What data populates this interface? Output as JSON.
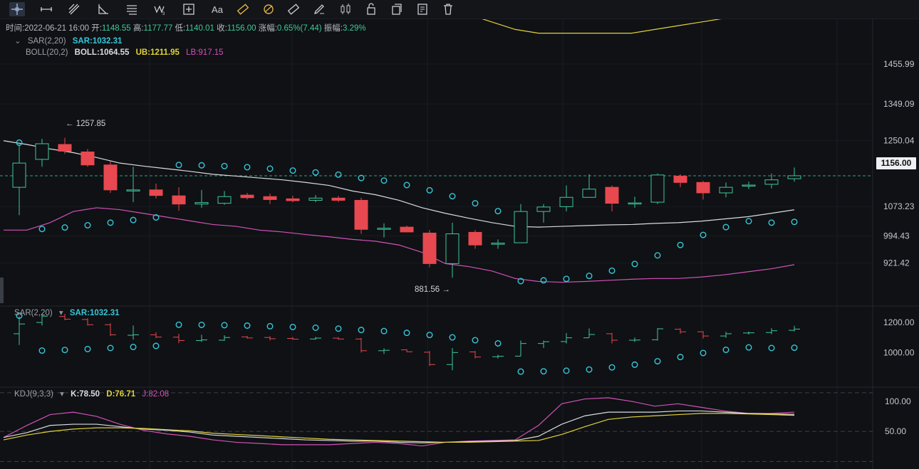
{
  "toolbar": {
    "icons": [
      "crosshair-icon",
      "horizontal-line-icon",
      "parallel-channel-icon",
      "triangle-icon",
      "fib-lines-icon",
      "wave-icon",
      "measure-icon",
      "text-icon",
      "pattern-icon",
      "gann-icon",
      "ruler-icon",
      "brush-icon",
      "candle-icon",
      "lock-icon",
      "copy-icon",
      "note-icon",
      "trash-icon"
    ],
    "text_tool": "Aa"
  },
  "header": {
    "time_label": "时间:",
    "time": "2022-06-21 16:00",
    "open_label": "开:",
    "open": "1148.55",
    "high_label": "高:",
    "high": "1177.77",
    "low_label": "低:",
    "low": "1140.01",
    "close_label": "收:",
    "close": "1156.00",
    "chg_label": "涨幅:",
    "chg": "0.65%(7.44)",
    "amp_label": "振幅:",
    "amp": "3.29%"
  },
  "legends": {
    "main_sar_name": "SAR(2,20)",
    "main_sar_value": "SAR:1032.31",
    "boll_name": "BOLL(20,2)",
    "boll_mid": "BOLL:1064.55",
    "boll_ub": "UB:1211.95",
    "boll_lb": "LB:917.15",
    "sub_sar_name": "SAR(2,20)",
    "sub_sar_value": "SAR:1032.31",
    "kdj_name": "KDJ(9,3,3)",
    "kdj_k": "K:78.50",
    "kdj_d": "D:76.71",
    "kdj_j": "J:82.08"
  },
  "annotations": {
    "high_mark": "← 1257.85",
    "low_mark": "881.56 →"
  },
  "price_tag": "1156.00",
  "colors": {
    "up": "#3fc89a",
    "down": "#e8484f",
    "ub": "#e2d23a",
    "mid": "#d8dbe0",
    "lb": "#d451b8",
    "sar": "#36c6d8",
    "k": "#d8dbe0",
    "d": "#e2d23a",
    "j": "#d451b8",
    "bg": "#0f1114"
  },
  "chart_data": {
    "type": "candlestick",
    "price_axis": {
      "ticks": [
        "1455.99",
        "1349.09",
        "1250.04",
        "1156.00",
        "1073.23",
        "994.43",
        "921.42"
      ],
      "ylim": [
        850,
        1500
      ]
    },
    "sar_axis": {
      "ticks": [
        "1200.00",
        "1000.00"
      ],
      "ylim": [
        850,
        1300
      ]
    },
    "kdj_axis": {
      "ticks": [
        "100.00",
        "50.00"
      ],
      "ylim": [
        -10,
        120
      ]
    },
    "candles": [
      {
        "o": 1125,
        "h": 1240,
        "l": 1050,
        "c": 1190
      },
      {
        "o": 1200,
        "h": 1255,
        "l": 1180,
        "c": 1242
      },
      {
        "o": 1240,
        "h": 1258,
        "l": 1215,
        "c": 1222
      },
      {
        "o": 1220,
        "h": 1228,
        "l": 1180,
        "c": 1185
      },
      {
        "o": 1185,
        "h": 1195,
        "l": 1110,
        "c": 1118
      },
      {
        "o": 1115,
        "h": 1180,
        "l": 1085,
        "c": 1118
      },
      {
        "o": 1118,
        "h": 1135,
        "l": 1095,
        "c": 1103
      },
      {
        "o": 1102,
        "h": 1125,
        "l": 1062,
        "c": 1080
      },
      {
        "o": 1080,
        "h": 1118,
        "l": 1070,
        "c": 1084
      },
      {
        "o": 1082,
        "h": 1115,
        "l": 1078,
        "c": 1100
      },
      {
        "o": 1104,
        "h": 1110,
        "l": 1092,
        "c": 1097
      },
      {
        "o": 1100,
        "h": 1108,
        "l": 1080,
        "c": 1092
      },
      {
        "o": 1094,
        "h": 1102,
        "l": 1085,
        "c": 1089
      },
      {
        "o": 1090,
        "h": 1104,
        "l": 1085,
        "c": 1096
      },
      {
        "o": 1096,
        "h": 1102,
        "l": 1085,
        "c": 1090
      },
      {
        "o": 1090,
        "h": 1097,
        "l": 1000,
        "c": 1012
      },
      {
        "o": 1012,
        "h": 1028,
        "l": 990,
        "c": 1015
      },
      {
        "o": 1018,
        "h": 1022,
        "l": 1004,
        "c": 1005
      },
      {
        "o": 1002,
        "h": 1010,
        "l": 910,
        "c": 920
      },
      {
        "o": 920,
        "h": 1030,
        "l": 882,
        "c": 1000
      },
      {
        "o": 1004,
        "h": 1010,
        "l": 960,
        "c": 970
      },
      {
        "o": 972,
        "h": 985,
        "l": 960,
        "c": 975
      },
      {
        "o": 976,
        "h": 1080,
        "l": 975,
        "c": 1060
      },
      {
        "o": 1060,
        "h": 1080,
        "l": 1030,
        "c": 1072
      },
      {
        "o": 1073,
        "h": 1130,
        "l": 1060,
        "c": 1098
      },
      {
        "o": 1098,
        "h": 1160,
        "l": 1098,
        "c": 1120
      },
      {
        "o": 1125,
        "h": 1130,
        "l": 1060,
        "c": 1082
      },
      {
        "o": 1082,
        "h": 1100,
        "l": 1070,
        "c": 1083
      },
      {
        "o": 1085,
        "h": 1162,
        "l": 1080,
        "c": 1158
      },
      {
        "o": 1155,
        "h": 1160,
        "l": 1125,
        "c": 1138
      },
      {
        "o": 1138,
        "h": 1142,
        "l": 1092,
        "c": 1110
      },
      {
        "o": 1110,
        "h": 1138,
        "l": 1098,
        "c": 1125
      },
      {
        "o": 1130,
        "h": 1140,
        "l": 1120,
        "c": 1131
      },
      {
        "o": 1133,
        "h": 1162,
        "l": 1122,
        "c": 1145
      },
      {
        "o": 1148,
        "h": 1178,
        "l": 1140,
        "c": 1156
      }
    ],
    "sar": [
      1245,
      1013,
      1017,
      1023,
      1030,
      1037,
      1044,
      1185,
      1184,
      1182,
      1179,
      1175,
      1170,
      1165,
      1159,
      1150,
      1143,
      1131,
      1117,
      1101,
      1082,
      1061,
      873,
      875,
      879,
      887,
      901,
      919,
      942,
      970,
      997,
      1018,
      1034,
      1030,
      1032
    ],
    "boll_ub": [
      1490,
      1475,
      1450,
      1420,
      1390,
      1370,
      1360,
      1360,
      1360,
      1358,
      1355,
      1352,
      1350,
      1348,
      1345,
      1342,
      1340,
      1342,
      1350,
      1348,
      1350,
      1330,
      1310,
      1300,
      1300,
      1300,
      1300,
      1300,
      1310,
      1320,
      1330,
      1340,
      1350,
      1360,
      1370
    ],
    "boll_mid": [
      1250,
      1240,
      1228,
      1218,
      1205,
      1190,
      1182,
      1175,
      1168,
      1160,
      1155,
      1150,
      1145,
      1138,
      1130,
      1115,
      1105,
      1090,
      1070,
      1055,
      1042,
      1030,
      1020,
      1018,
      1020,
      1022,
      1024,
      1025,
      1028,
      1030,
      1034,
      1040,
      1046,
      1055,
      1064.55
    ],
    "boll_lb": [
      1010,
      1010,
      1030,
      1060,
      1070,
      1065,
      1055,
      1045,
      1035,
      1025,
      1020,
      1010,
      1005,
      998,
      992,
      985,
      980,
      970,
      950,
      920,
      912,
      900,
      880,
      872,
      870,
      872,
      875,
      878,
      880,
      880,
      884,
      890,
      898,
      906,
      917.15
    ],
    "kdj": {
      "k": [
        40,
        48,
        60,
        62,
        62,
        58,
        54,
        52,
        49,
        44,
        42,
        40,
        38,
        36,
        35,
        34,
        34,
        32,
        31,
        32,
        33,
        34,
        35,
        42,
        62,
        76,
        82,
        82,
        82,
        84,
        84,
        82,
        80,
        79,
        78.5
      ],
      "d": [
        36,
        44,
        50,
        54,
        56,
        56,
        55,
        53,
        51,
        47,
        45,
        43,
        41,
        39,
        37,
        36,
        35,
        34,
        33,
        32,
        32,
        33,
        34,
        35,
        45,
        58,
        70,
        74,
        76,
        78,
        80,
        80,
        79,
        78,
        76.71
      ],
      "j": [
        40,
        60,
        78,
        82,
        75,
        62,
        52,
        46,
        42,
        36,
        32,
        30,
        28,
        28,
        28,
        30,
        32,
        30,
        26,
        32,
        34,
        35,
        36,
        60,
        96,
        104,
        106,
        100,
        92,
        96,
        90,
        84,
        80,
        80,
        82.08
      ]
    }
  }
}
